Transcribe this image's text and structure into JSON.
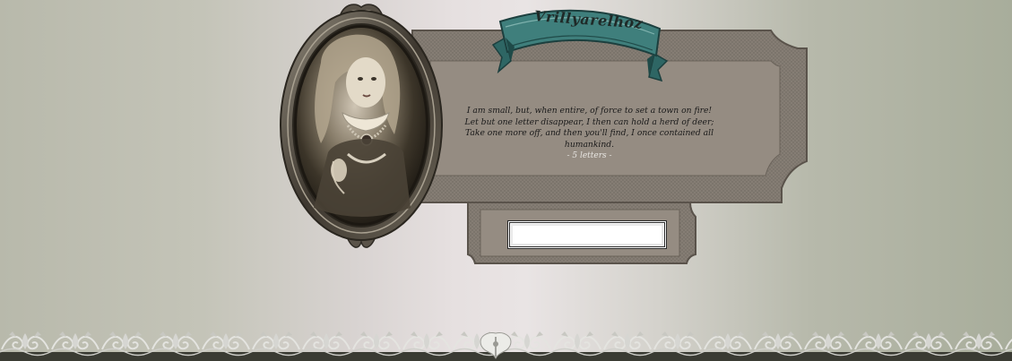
{
  "banner": {
    "title": "Vrillyarelhoz"
  },
  "riddle": {
    "lines": [
      "I am small, but, when entire, of force to set a town on fire!",
      "Let but one letter disappear, I then can hold a herd of deer;",
      "Take one more off, and then you'll find, I once contained all humankind."
    ],
    "hint": "- 5 letters -"
  },
  "answer": {
    "value": "",
    "placeholder": ""
  },
  "colors": {
    "panel": "#938a80",
    "panel_border": "#5e574f",
    "banner": "#3d7a78",
    "frame": "#4a443c"
  },
  "icons": {
    "portrait": "doll-portrait-icon",
    "border": "floral-border-icon"
  }
}
